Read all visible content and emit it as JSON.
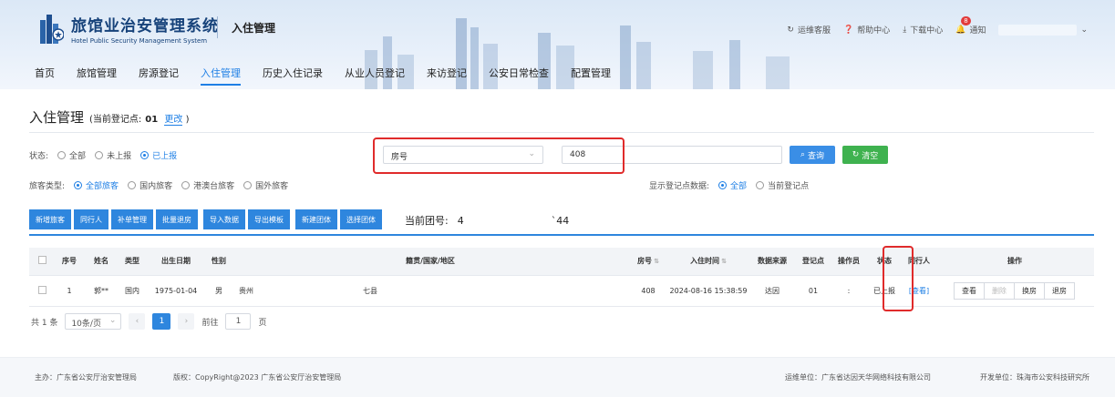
{
  "header": {
    "system_title": "旅馆业治安管理系统",
    "system_subtitle": "Hotel Public Security Management System",
    "module_title": "入住管理",
    "links": {
      "support": "运维客服",
      "help": "帮助中心",
      "download": "下载中心",
      "notify": "通知",
      "notify_count": "8"
    }
  },
  "nav": {
    "items": [
      "首页",
      "旅馆管理",
      "房源登记",
      "入住管理",
      "历史入住记录",
      "从业人员登记",
      "来访登记",
      "公安日常检查",
      "配置管理"
    ],
    "active_index": 3
  },
  "page": {
    "title": "入住管理",
    "point_label": "(当前登记点:",
    "point_value": "01",
    "edit_label": "更改",
    "point_close": ")"
  },
  "filters": {
    "status_label": "状态:",
    "status_options": [
      "全部",
      "未上报",
      "已上报"
    ],
    "status_selected": 2,
    "guest_type_label": "旅客类型:",
    "guest_type_options": [
      "全部旅客",
      "国内旅客",
      "港澳台旅客",
      "国外旅客"
    ],
    "guest_type_selected": 0,
    "field_select": "房号",
    "search_value": "408",
    "query_label": "查询",
    "clear_label": "清空",
    "show_data_label": "显示登记点数据:",
    "show_data_options": [
      "全部",
      "当前登记点"
    ],
    "show_data_selected": 0
  },
  "toolbar": {
    "buttons": [
      "新增旅客",
      "同行人",
      "补单管理",
      "批量退房",
      "导入数据",
      "导出模板",
      "新建团体",
      "选择团体"
    ],
    "group_label": "当前团号:",
    "group_value_start": "4",
    "group_value_end": "`44"
  },
  "table": {
    "headers": [
      "序号",
      "姓名",
      "类型",
      "出生日期",
      "性别",
      "籍贯/国家/地区",
      "房号",
      "入住时间",
      "数据来源",
      "登记点",
      "操作员",
      "状态",
      "同行人",
      "操作"
    ],
    "rows": [
      {
        "index": "1",
        "name": "郭**",
        "type": "国内",
        "birth": "1975-01-04",
        "gender": "男",
        "origin_start": "贵州",
        "origin_end": "七县",
        "room": "408",
        "checkin": "2024-08-16 15:38:59",
        "source": "达因",
        "point": "01",
        "operator": ":",
        "status": "已上报",
        "companion": "[查看]",
        "actions": [
          "查看",
          "删除",
          "换房",
          "退房"
        ]
      }
    ]
  },
  "pager": {
    "total": "共 1 条",
    "page_size": "10条/页",
    "current": "1",
    "goto_label": "前往",
    "goto_value": "1",
    "page_unit": "页"
  },
  "footer": {
    "host": "主办：广东省公安厅治安管理局",
    "copyright": "版权：CopyRight@2023 广东省公安厅治安管理局",
    "ops": "运维单位：广东省达因天华网络科技有限公司",
    "dev": "开发单位：珠海市公安科技研究所"
  },
  "colors": {
    "primary": "#2e86de",
    "success": "#3fb24f",
    "highlight": "#e02b2b"
  }
}
